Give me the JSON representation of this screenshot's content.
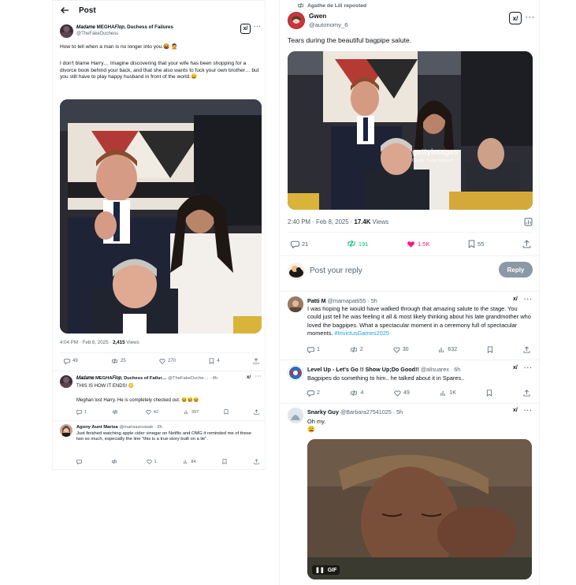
{
  "left": {
    "header_title": "Post",
    "main_post": {
      "author_name": "𝑀𝑎𝑑𝑎𝑚𝑒 MEGHA𝐹𝑙𝑜𝑝, Duchess of Failures",
      "handle": "@TheFakeDuchess",
      "text_1": "How to tell when a man is no longer into you.🤬 🤦",
      "text_2": "I don't blame Harry… Imagine discovering that your wife has been shopping for a divorce book behind your back, and that she also wants to fuck your own brother… but you still have to play happy husband in front of the world.😀",
      "time": "4:04 PM · Feb 8, 2025 · ",
      "views_count": "2,415",
      "views_label": " Views",
      "replies": "49",
      "reposts": "25",
      "likes": "270",
      "bookmarks": "4"
    },
    "reply1": {
      "author_name": "𝑀𝑎𝑑𝑎𝑚𝑒 MEGHA𝐹𝑙𝑜𝑝, Duchess of Failur…",
      "handle_time": "@TheFakeDuche… · 4h",
      "text_1": "THIS IS HOW IT ENDS! 😳",
      "text_2": "Meghan lost Harry. He is completely checked out. 😆😆😆",
      "replies": "1",
      "reposts": "",
      "likes": "42",
      "views": "397"
    },
    "reply2": {
      "author_name": "Agony Aunt Marisa",
      "handle_time": "@marisasnowak · 2h",
      "text": "Just finished watching apple cider vinegar on Netflix and OMG it reminded me of these two so much, especially the line \"this is a true story built on a lie\".",
      "replies": "",
      "reposts": "",
      "likes": "1",
      "views": "84"
    }
  },
  "right": {
    "repost_banner": "Agathe de Lili reposted",
    "main_post": {
      "author_name": "Gwen",
      "handle": "@autonomy_6",
      "text": "Tears during the beautiful bagpipe salute.",
      "watermark_brand": "gettyimages",
      "watermark_credit": "Credit: Samir Hussein",
      "time": "2:40 PM · Feb 8, 2025 · ",
      "views_count": "17.4K",
      "views_label": " Views",
      "replies": "21",
      "reposts": "191",
      "likes": "1.5K",
      "bookmarks": "55"
    },
    "reply_box": {
      "placeholder": "Post your reply",
      "button": "Reply"
    },
    "reply1": {
      "author_name": "Patti M",
      "handle_time": "@mamapatti55 · 5h",
      "text": "I was hoping he would have walked through that amazing salute to the stage. You could just tell he was feeling it all & most likely thinking about his late grandmother who loved the bagpipes. What a spectacular moment in a ceremony full of spectacular moments. ",
      "hashtag": "#InvictusGames2025",
      "replies": "1",
      "reposts": "2",
      "likes": "30",
      "views": "632"
    },
    "reply2": {
      "author_name": "Level Up - Let's Go !! Show Up;Do Good!!",
      "handle_time": "@alisuarex · 6h",
      "text": "Bagpipes do something to him.. he talked about it in Spares..",
      "replies": "2",
      "reposts": "4",
      "likes": "49",
      "views": "1K"
    },
    "reply3": {
      "author_name": "Snarky Guy",
      "handle_time": "@Barbara27541025 · 5h",
      "text": "Oh my.",
      "emoji": "😩",
      "gif_label": "GIF"
    }
  }
}
